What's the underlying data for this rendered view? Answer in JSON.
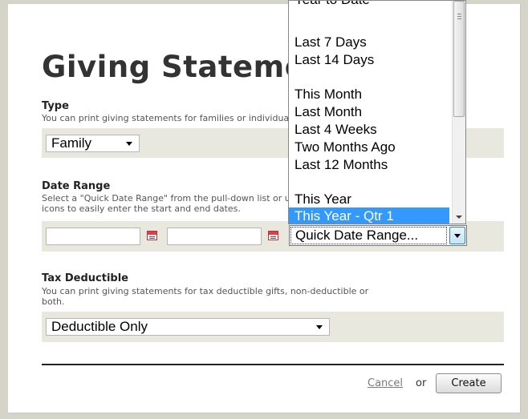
{
  "page": {
    "title": "Giving Statements"
  },
  "type_section": {
    "title": "Type",
    "description": "You can print giving statements for families or individuals.",
    "selected": "Family"
  },
  "date_range_section": {
    "title": "Date Range",
    "description_line1": "Select a \"Quick Date Range\" from the pull-down list or use the calendar",
    "description_line2": "icons to easily enter the start and end dates.",
    "start_date_value": "",
    "end_date_value": "",
    "quick_range_selected": "Quick Date Range...",
    "quick_range_options": [
      "Year to Date",
      "Last 7 Days",
      "Last 14 Days",
      "This Month",
      "Last Month",
      "Last 4 Weeks",
      "Two Months Ago",
      "Last 12 Months",
      "This Year",
      "This Year - Qtr 1"
    ],
    "highlighted_option": "This Year - Qtr 1"
  },
  "tax_section": {
    "title": "Tax Deductible",
    "description_line1": "You can print giving statements for tax deductible gifts, non-deductible or",
    "description_line2": "both.",
    "selected": "Deductible Only"
  },
  "footer": {
    "cancel_label": "Cancel",
    "or_label": "or",
    "create_label": "Create"
  },
  "colors": {
    "band": "#e8e8de",
    "highlight": "#3399ff",
    "outer": "#d4d4c8"
  }
}
